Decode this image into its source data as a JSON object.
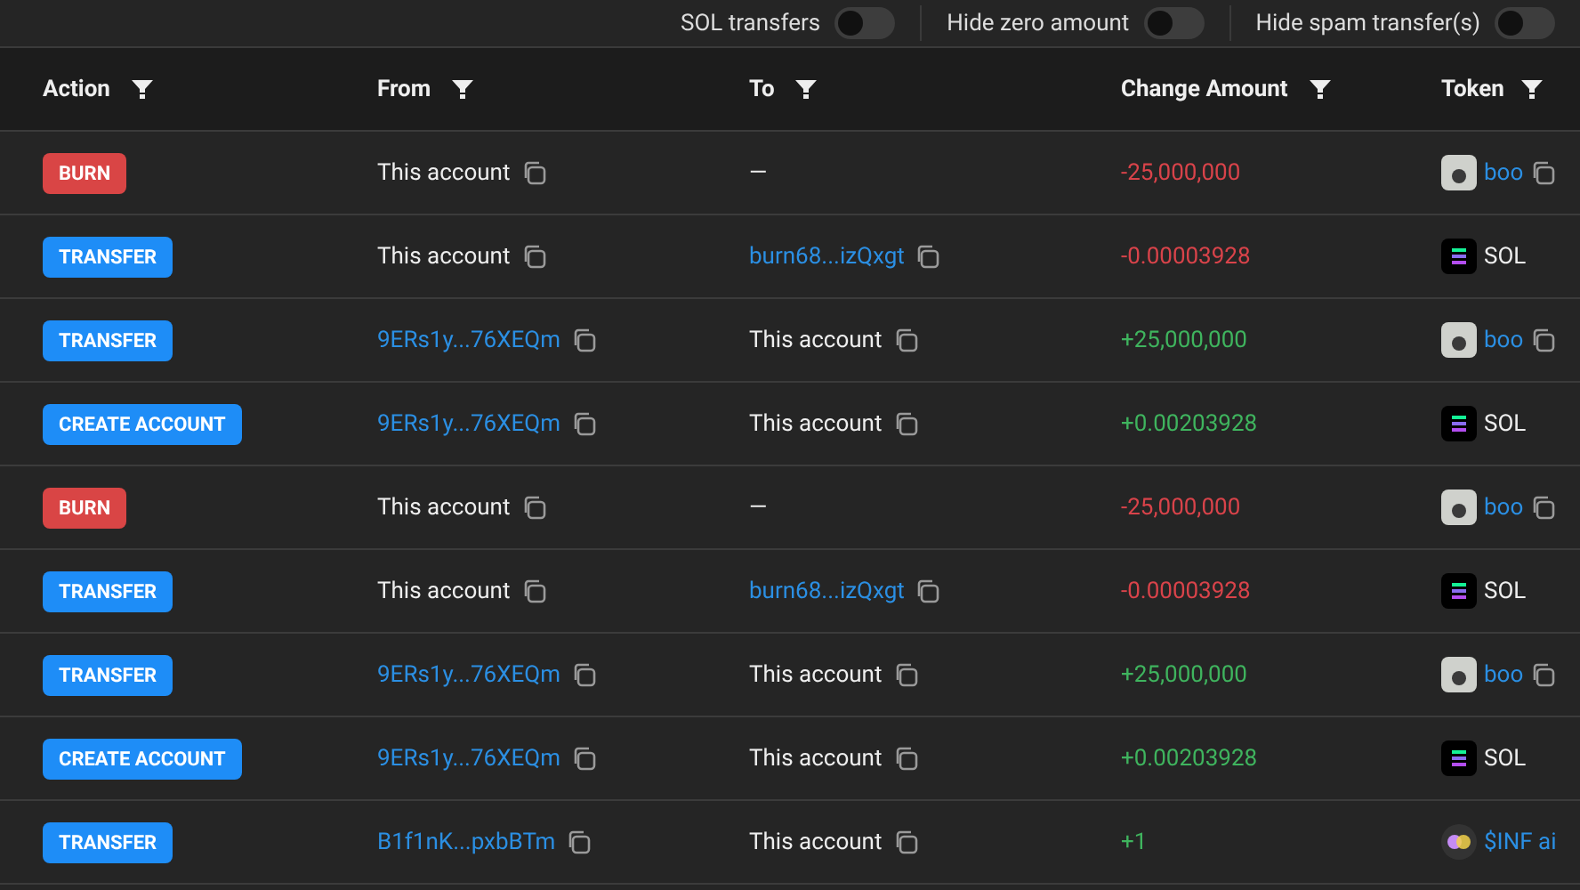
{
  "filters": [
    {
      "label": "SOL transfers",
      "on": false
    },
    {
      "label": "Hide zero amount",
      "on": false
    },
    {
      "label": "Hide spam transfer(s)",
      "on": false
    }
  ],
  "table": {
    "columns": [
      "Action",
      "From",
      "To",
      "Change Amount",
      "Token"
    ],
    "rows": [
      {
        "action": {
          "label": "BURN",
          "kind": "burn"
        },
        "from": {
          "text": "This account",
          "link": false,
          "copy": true
        },
        "to": {
          "text": "—",
          "link": false,
          "copy": false
        },
        "amount": {
          "text": "-25,000,000",
          "kind": "debit"
        },
        "token": {
          "text": "boo",
          "kind": "boo",
          "link": true,
          "copy": true
        }
      },
      {
        "action": {
          "label": "TRANSFER",
          "kind": "transfer"
        },
        "from": {
          "text": "This account",
          "link": false,
          "copy": true
        },
        "to": {
          "text": "burn68...izQxgt",
          "link": true,
          "copy": true
        },
        "amount": {
          "text": "-0.00003928",
          "kind": "debit"
        },
        "token": {
          "text": "SOL",
          "kind": "sol",
          "link": false,
          "copy": false
        }
      },
      {
        "action": {
          "label": "TRANSFER",
          "kind": "transfer"
        },
        "from": {
          "text": "9ERs1y...76XEQm",
          "link": true,
          "copy": true
        },
        "to": {
          "text": "This account",
          "link": false,
          "copy": true
        },
        "amount": {
          "text": "+25,000,000",
          "kind": "credit"
        },
        "token": {
          "text": "boo",
          "kind": "boo",
          "link": true,
          "copy": true
        }
      },
      {
        "action": {
          "label": "CREATE ACCOUNT",
          "kind": "create"
        },
        "from": {
          "text": "9ERs1y...76XEQm",
          "link": true,
          "copy": true
        },
        "to": {
          "text": "This account",
          "link": false,
          "copy": true
        },
        "amount": {
          "text": "+0.00203928",
          "kind": "credit"
        },
        "token": {
          "text": "SOL",
          "kind": "sol",
          "link": false,
          "copy": false
        }
      },
      {
        "action": {
          "label": "BURN",
          "kind": "burn"
        },
        "from": {
          "text": "This account",
          "link": false,
          "copy": true
        },
        "to": {
          "text": "—",
          "link": false,
          "copy": false
        },
        "amount": {
          "text": "-25,000,000",
          "kind": "debit"
        },
        "token": {
          "text": "boo",
          "kind": "boo",
          "link": true,
          "copy": true
        }
      },
      {
        "action": {
          "label": "TRANSFER",
          "kind": "transfer"
        },
        "from": {
          "text": "This account",
          "link": false,
          "copy": true
        },
        "to": {
          "text": "burn68...izQxgt",
          "link": true,
          "copy": true
        },
        "amount": {
          "text": "-0.00003928",
          "kind": "debit"
        },
        "token": {
          "text": "SOL",
          "kind": "sol",
          "link": false,
          "copy": false
        }
      },
      {
        "action": {
          "label": "TRANSFER",
          "kind": "transfer"
        },
        "from": {
          "text": "9ERs1y...76XEQm",
          "link": true,
          "copy": true
        },
        "to": {
          "text": "This account",
          "link": false,
          "copy": true
        },
        "amount": {
          "text": "+25,000,000",
          "kind": "credit"
        },
        "token": {
          "text": "boo",
          "kind": "boo",
          "link": true,
          "copy": true
        }
      },
      {
        "action": {
          "label": "CREATE ACCOUNT",
          "kind": "create"
        },
        "from": {
          "text": "9ERs1y...76XEQm",
          "link": true,
          "copy": true
        },
        "to": {
          "text": "This account",
          "link": false,
          "copy": true
        },
        "amount": {
          "text": "+0.00203928",
          "kind": "credit"
        },
        "token": {
          "text": "SOL",
          "kind": "sol",
          "link": false,
          "copy": false
        }
      },
      {
        "action": {
          "label": "TRANSFER",
          "kind": "transfer"
        },
        "from": {
          "text": "B1f1nK...pxbBTm",
          "link": true,
          "copy": true
        },
        "to": {
          "text": "This account",
          "link": false,
          "copy": true
        },
        "amount": {
          "text": "+1",
          "kind": "credit"
        },
        "token": {
          "text": "$INF ai",
          "kind": "inf",
          "link": true,
          "copy": false
        }
      }
    ]
  }
}
